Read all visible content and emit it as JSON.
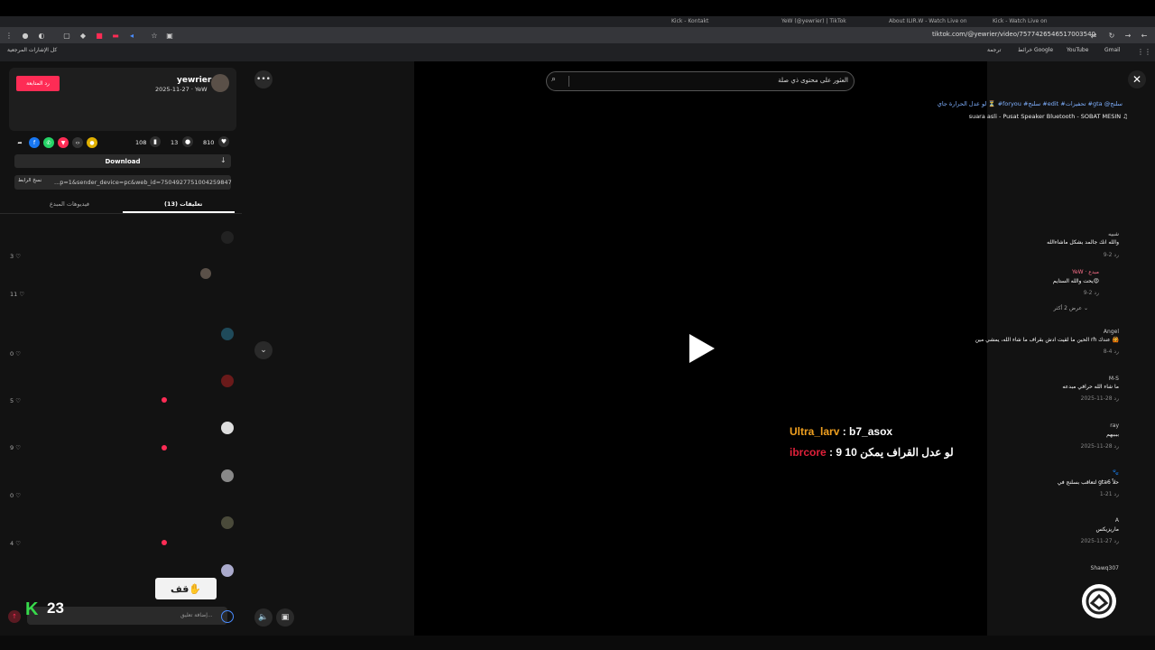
{
  "browser": {
    "tabs": [
      "Kick - Kontakt",
      "YeW (@yewrier) | TikTok",
      "About ILIR.W - Watch Live on",
      "Kick - Watch Live on"
    ],
    "url": "tiktok.com/@yewrier/video/7577426546517003540",
    "bookmarks": {
      "all": "كل الإشارات المرجعية",
      "gmail": "Gmail",
      "youtube": "YouTube",
      "maps": "خرائط Google",
      "translate": "ترجمة"
    }
  },
  "post": {
    "follow_label": "رد المتابعة",
    "username": "yewrier",
    "date": "2025-11-27 · YeW",
    "caption": "لو عدل الحرارة جاي ⏳ #foryou #سلنج #edit #تحفيزات #gta @سلنج",
    "music": "suara asli - Pusat Speaker Bluetooth - SOBAT MESIN ♫",
    "likes": "810",
    "comments": "13",
    "saves": "108",
    "download_label": "Download",
    "copy_link_label": "نسخ الرابط",
    "link_text": "...p=1&sender_device=pc&web_id=7504927751004259847",
    "tabs": {
      "comments": "تعليقات (13)",
      "creator_videos": "فيديوهات المبدع"
    }
  },
  "comments": [
    {
      "name": "شبيه",
      "text": "والله انك جالمد بشكل ماشاءالله",
      "meta": "9-2   رد",
      "likes": "3"
    },
    {
      "name": "YeW · مبدع",
      "text": "يحت والله الستايم😍",
      "meta": "9-2   رد",
      "likes": "11",
      "reply": true
    },
    {
      "name": "Angel",
      "text": "الحين ما لقيت ادش بقراف ما شاء الله، يمشي مين rh عندك 🙆",
      "meta": "8-4   رد",
      "likes": "0"
    },
    {
      "name": "M-S",
      "text": "ما شاء الله حرافي مبدعه",
      "meta": "2025-11-28   رد",
      "likes": "5"
    },
    {
      "name": "ray",
      "text": "ببببهم",
      "meta": "2025-11-28   رد",
      "likes": "9"
    },
    {
      "name": "🐾",
      "text": "لتعاقب بسلنج في gta6 حلاً",
      "meta": "1-21   رد",
      "likes": "0"
    },
    {
      "name": "A",
      "text": "ماريزيكس",
      "meta": "2025-11-27   رد",
      "likes": "4"
    },
    {
      "name": "Shawq307",
      "text": "",
      "meta": "",
      "likes": ""
    }
  ],
  "show_more": "عرض 2 أكثر",
  "sticker_text": "قف✋",
  "comment_input_placeholder": "إضافة تعليق...",
  "kick_counter": "23",
  "search_placeholder": "العثور على محتوى ذي صلة",
  "overlay": {
    "line1_name": "Ultra_larv",
    "line1_text": " : b7_asox",
    "line2_name": "ibrcore",
    "line2_text": " : لو عدل القراف يمكن 10 9"
  },
  "colors": {
    "accent": "#fe2c55",
    "overlay_orange": "#f0a020",
    "overlay_red": "#e0203a",
    "kick_green": "#37d94b"
  }
}
